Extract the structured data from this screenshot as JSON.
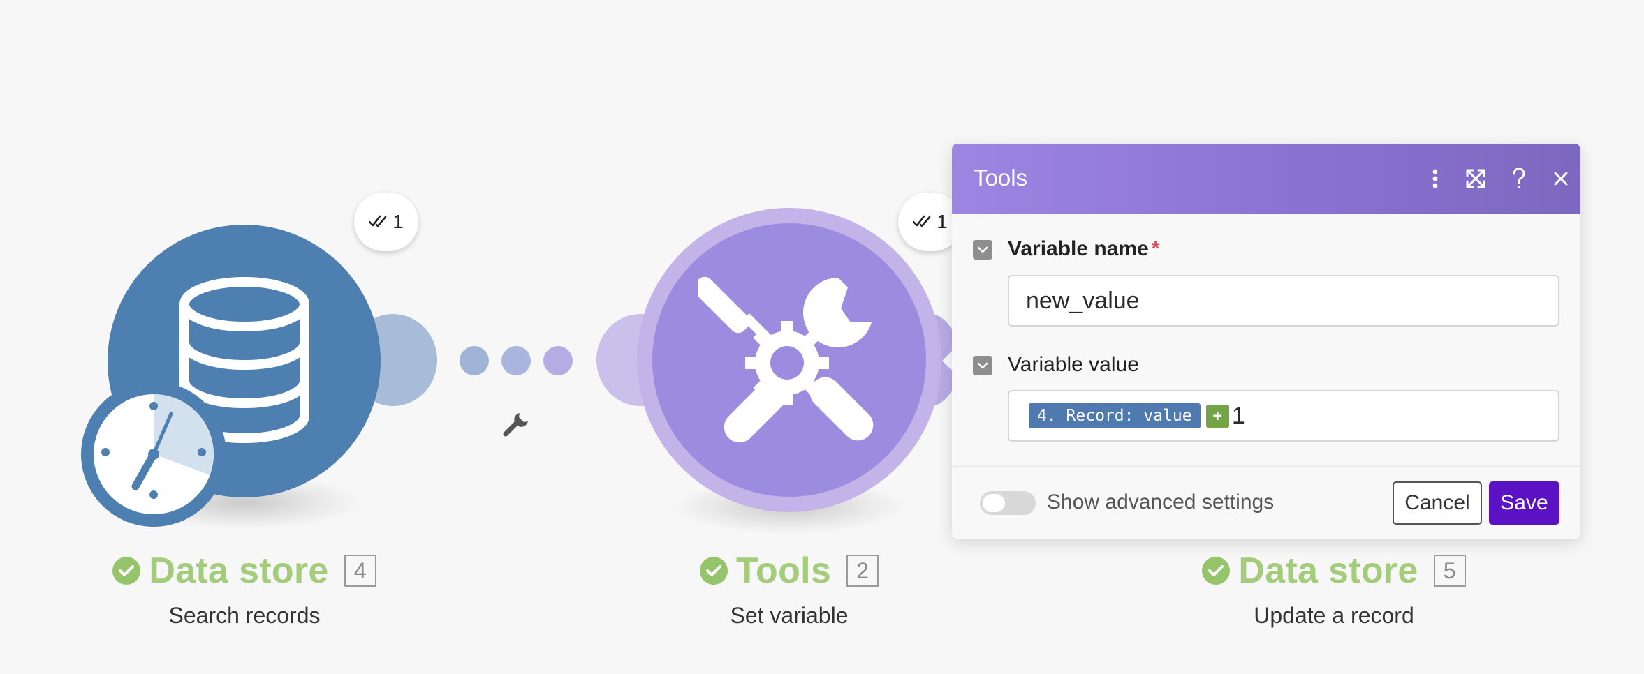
{
  "colors": {
    "data_store": "#4d7fb0",
    "tools": "#9c8ce0",
    "success": "#a4cd7b",
    "header": "#8a72d2",
    "save": "#5a12c4"
  },
  "modules": [
    {
      "name": "Data store",
      "number": "4",
      "subtitle": "Search records",
      "operations": "1",
      "icon": "database-clock-icon"
    },
    {
      "name": "Tools",
      "number": "2",
      "subtitle": "Set variable",
      "operations": "1",
      "icon": "tools-icon"
    },
    {
      "name": "Data store",
      "number": "5",
      "subtitle": "Update a record",
      "icon": "database-icon"
    }
  ],
  "dialog": {
    "title": "Tools",
    "fields": {
      "variable_name": {
        "label": "Variable name",
        "required_mark": "*",
        "value": "new_value"
      },
      "variable_value": {
        "label": "Variable value",
        "token": "4. Record: value",
        "operator": "+",
        "suffix": "1"
      }
    },
    "advanced_label": "Show advanced settings",
    "advanced_enabled": false,
    "cancel_label": "Cancel",
    "save_label": "Save"
  }
}
